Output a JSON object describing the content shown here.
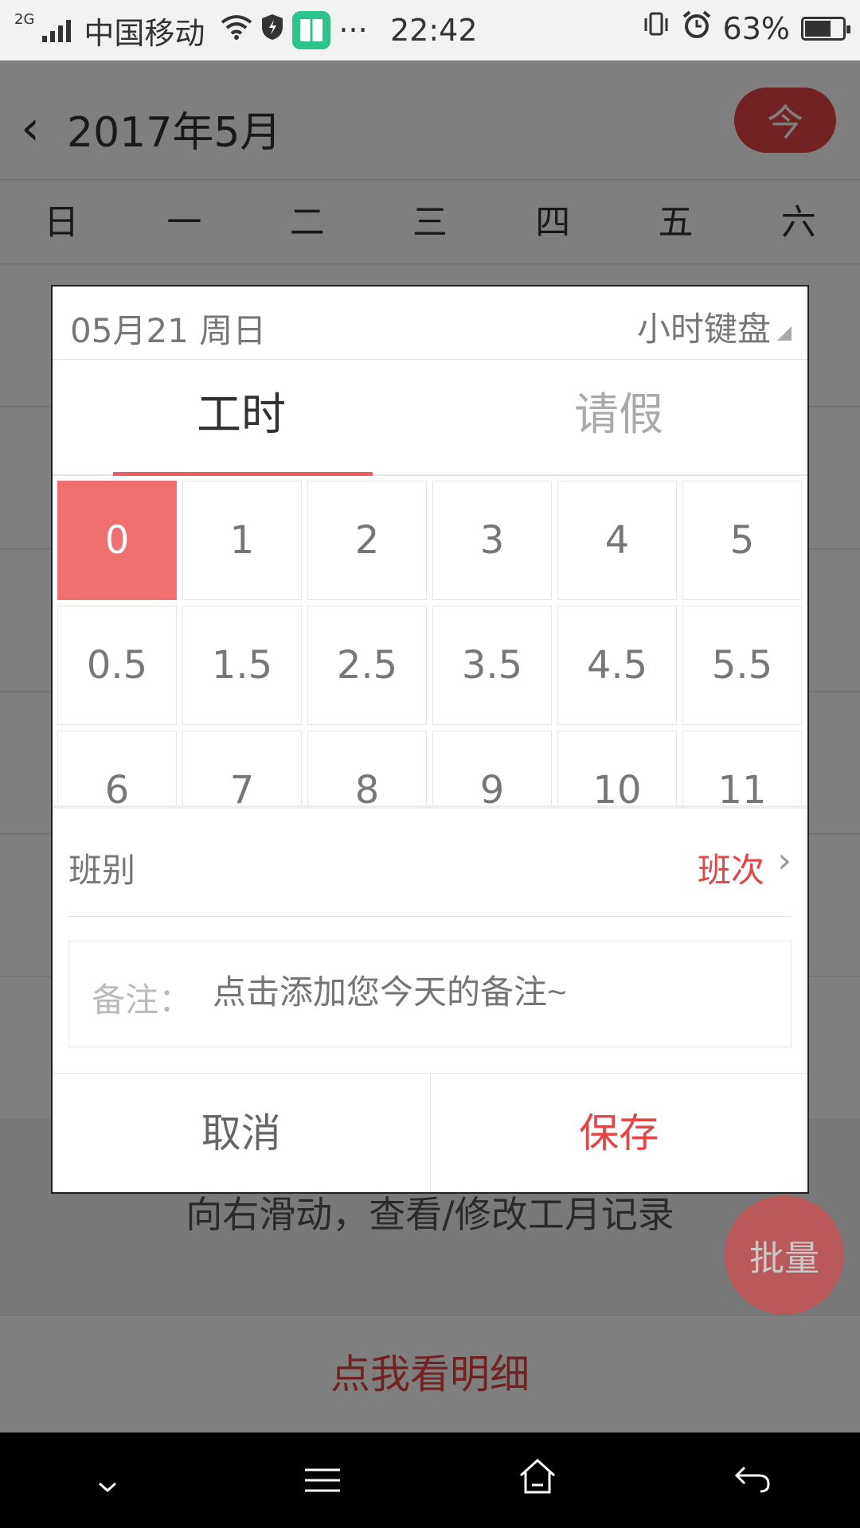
{
  "status_bar": {
    "network": "2G",
    "carrier": "中国移动",
    "more": "···",
    "time": "22:42",
    "battery": "63%",
    "battery_level": 0.63
  },
  "header": {
    "back_icon": "chevron-left",
    "title": "2017年5月",
    "today_label": "今"
  },
  "weekdays": [
    "日",
    "一",
    "二",
    "三",
    "四",
    "五",
    "六"
  ],
  "background": {
    "hint": "向右滑动，查看/修改工月记录",
    "batch_label": "批量",
    "detail_link": "点我看明细"
  },
  "dialog": {
    "date": "05月21 周日",
    "keyboard_mode": "小时键盘",
    "tabs": [
      {
        "label": "工时",
        "active": true
      },
      {
        "label": "请假",
        "active": false
      }
    ],
    "hours": [
      [
        "0",
        "1",
        "2",
        "3",
        "4",
        "5"
      ],
      [
        "0.5",
        "1.5",
        "2.5",
        "3.5",
        "4.5",
        "5.5"
      ],
      [
        "6",
        "7",
        "8",
        "9",
        "10",
        "11"
      ]
    ],
    "selected_hour": "0",
    "shift_label": "班别",
    "shift_value": "班次",
    "note_label": "备注：",
    "note_placeholder": "点击添加您今天的备注~",
    "cancel_label": "取消",
    "save_label": "保存"
  },
  "colors": {
    "accent": "#e64545",
    "selected_cell": "#f07070"
  },
  "nav_bar": [
    "chevron-down",
    "menu",
    "home",
    "back"
  ]
}
